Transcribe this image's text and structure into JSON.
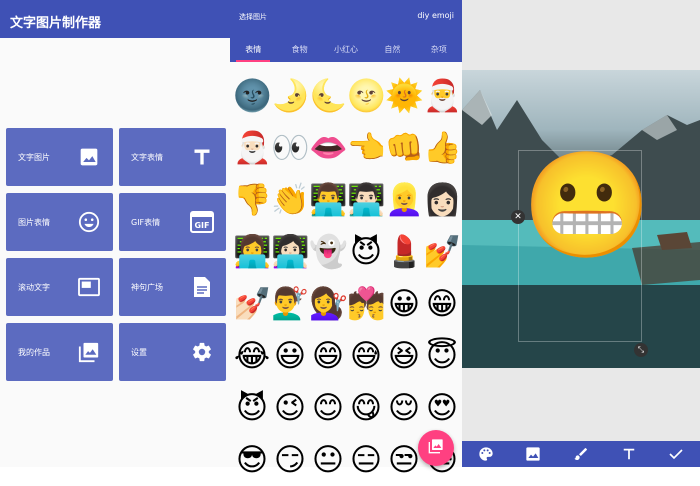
{
  "panel1": {
    "title": "文字图片制作器",
    "tiles": [
      {
        "label": "文字图片",
        "icon": "image-icon"
      },
      {
        "label": "文字表情",
        "icon": "text-icon"
      },
      {
        "label": "图片表情",
        "icon": "smiley-icon"
      },
      {
        "label": "GIF表情",
        "icon": "gif-icon"
      },
      {
        "label": "滚动文字",
        "icon": "featured-video-icon"
      },
      {
        "label": "神句广场",
        "icon": "document-icon"
      },
      {
        "label": "我的作品",
        "icon": "photo-library-icon"
      },
      {
        "label": "设置",
        "icon": "gear-icon"
      }
    ]
  },
  "panel2": {
    "title": "选择图片",
    "right_label": "diy emoji",
    "tabs": [
      "表情",
      "食物",
      "小红心",
      "自然",
      "杂项"
    ],
    "active_tab": "表情",
    "emojis": [
      "🌚",
      "🌛",
      "🌜",
      "🌝",
      "🌞",
      "🎅",
      "🎅🏻",
      "👀",
      "👄",
      "👈",
      "👊",
      "👍",
      "👎",
      "👏",
      "👨‍💻",
      "👨🏻‍💻",
      "👱‍♀️",
      "👩🏻",
      "👩‍💻",
      "👩🏻‍💻",
      "👻",
      "😈",
      "💄",
      "💅",
      "💅🏻",
      "💇‍♂️",
      "💇‍♀️",
      "💏",
      "😀",
      "😁",
      "😂",
      "😃",
      "😄",
      "😅",
      "😆",
      "😇",
      "😈",
      "😉",
      "😊",
      "😋",
      "😌",
      "😍",
      "😎",
      "😏",
      "😐",
      "😑",
      "😒",
      "😓"
    ]
  },
  "panel3": {
    "sticker": "😬",
    "toolbar": [
      "palette-icon",
      "image-icon",
      "brush-icon",
      "text-icon",
      "check-icon"
    ]
  },
  "colors": {
    "primary": "#3f51b5",
    "tile": "#5c6bc0",
    "accent": "#ff4081"
  }
}
